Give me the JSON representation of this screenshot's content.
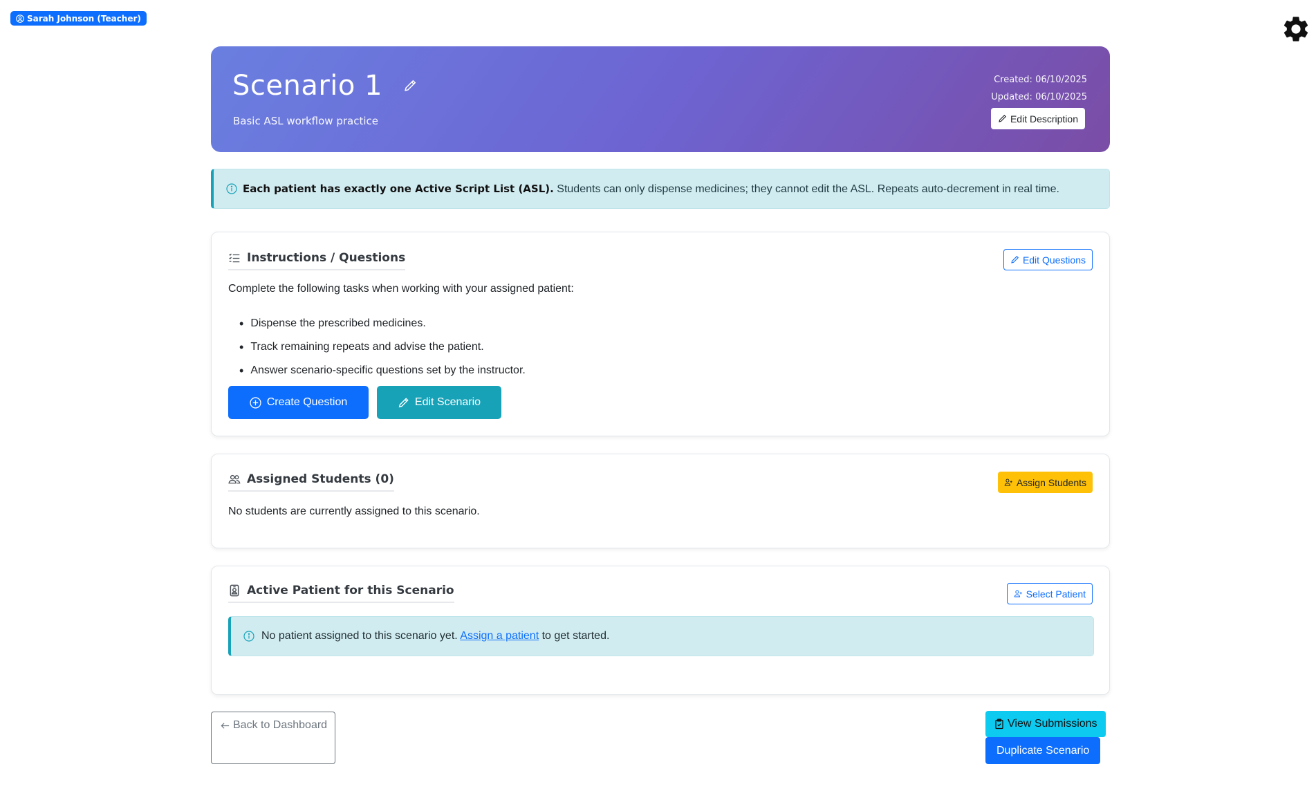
{
  "user": {
    "label": "Sarah Johnson (Teacher)"
  },
  "hero": {
    "title": "Scenario 1",
    "subtitle": "Basic ASL workflow practice",
    "created": "Created: 06/10/2025",
    "updated": "Updated: 06/10/2025",
    "edit_description_label": "Edit Description"
  },
  "notice": {
    "bold": "Each patient has exactly one Active Script List (ASL).",
    "text": " Students can only dispense medicines; they cannot edit the ASL. Repeats auto-decrement in real time."
  },
  "instructions": {
    "title": "Instructions / Questions",
    "edit_label": "Edit Questions",
    "intro": "Complete the following tasks when working with your assigned patient:",
    "tasks": [
      "Dispense the prescribed medicines.",
      "Track remaining repeats and advise the patient.",
      "Answer scenario-specific questions set by the instructor."
    ],
    "create_label": "Create Question",
    "edit_scenario_label": "Edit Scenario"
  },
  "students": {
    "title": "Assigned Students (0)",
    "assign_label": "Assign Students",
    "empty_text": "No students are currently assigned to this scenario."
  },
  "patient": {
    "title": "Active Patient for this Scenario",
    "select_label": "Select Patient",
    "alert_before": "No patient assigned to this scenario yet. ",
    "alert_link": "Assign a patient",
    "alert_after": " to get started."
  },
  "footer": {
    "back_label": "Back to Dashboard",
    "view_submissions_label": "View Submissions",
    "duplicate_label": "Duplicate Scenario"
  },
  "colors": {
    "primary": "#0d6efd",
    "info": "#17a2b8",
    "warning": "#ffc107",
    "hero_gradient_start": "#6a7fe0",
    "hero_gradient_end": "#7a4da6"
  },
  "icons": [
    "user-circle-icon",
    "gear-icon",
    "pencil-icon",
    "info-circle-icon",
    "list-icon",
    "people-icon",
    "plus-circle-icon",
    "person-plus-icon",
    "person-badge-icon",
    "arrow-left-icon",
    "clipboard-icon"
  ]
}
